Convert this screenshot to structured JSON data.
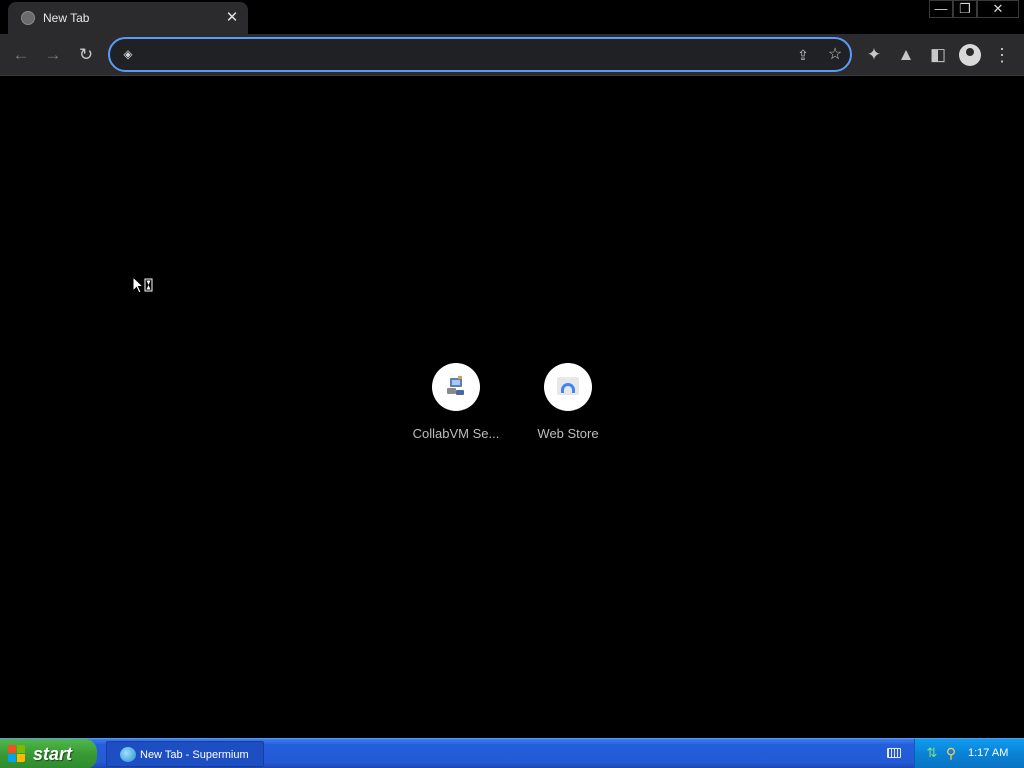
{
  "tab": {
    "title": "New Tab",
    "close_glyph": "✕",
    "icon": "globe-icon"
  },
  "window_controls": {
    "minimize": "—",
    "restore": "❐",
    "close": "✕"
  },
  "toolbar": {
    "back_glyph": "←",
    "forward_glyph": "→",
    "reload_glyph": "↻",
    "omnibox_value": "",
    "omnibox_icon_glyph": "◈",
    "share_glyph": "⇪",
    "star_glyph": "☆",
    "extensions_glyph": "✦",
    "labs_glyph": "▲",
    "sidepanel_glyph": "◧",
    "menu_glyph": "⋮"
  },
  "shortcuts": [
    {
      "label": "CollabVM Se...",
      "icon": "collabvm-icon"
    },
    {
      "label": "Web Store",
      "icon": "web-store-icon"
    }
  ],
  "taskbar": {
    "start_label": "start",
    "task_label": "New Tab - Supermium",
    "clock": "1:17 AM",
    "accent": "#245edb",
    "start_color": "#3a9a36",
    "tray_color": "#0a82d6"
  }
}
